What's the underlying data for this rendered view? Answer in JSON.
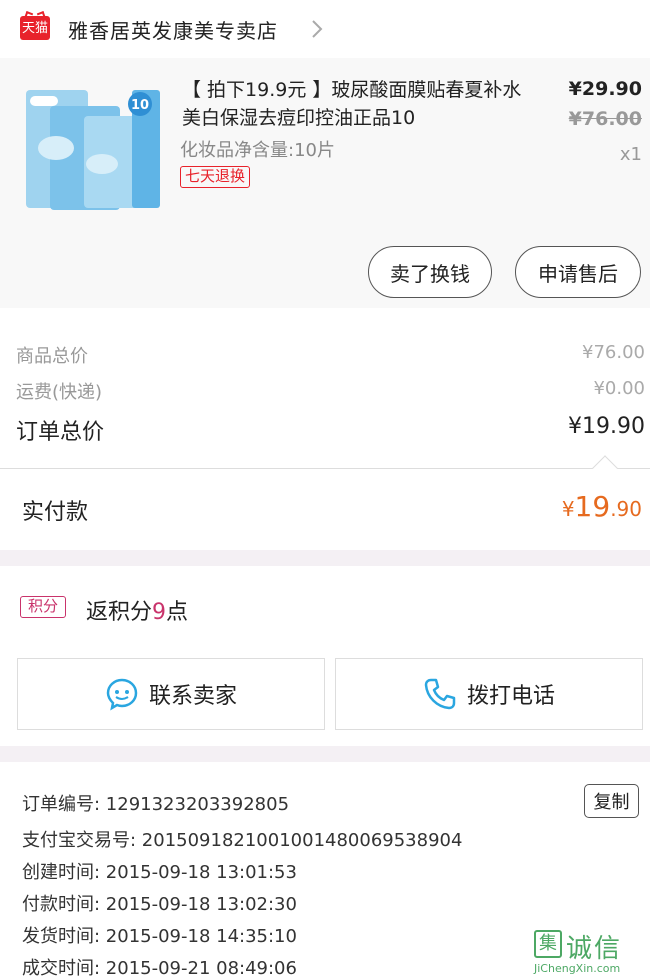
{
  "store": {
    "badge": "天猫",
    "name": "雅香居英发康美专卖店"
  },
  "product": {
    "title": "【 拍下19.9元 】玻尿酸面膜贴春夏补水美白保湿去痘印控油正品10",
    "spec": "化妆品净含量:10片",
    "return_badge": "七天退换",
    "price_now": "¥29.90",
    "price_old": "¥76.00",
    "qty": "x1",
    "image_badge": "10"
  },
  "actions": {
    "sell_label": "卖了换钱",
    "after_sale_label": "申请售后"
  },
  "summary": {
    "goods_total_label": "商品总价",
    "goods_total_value": "¥76.00",
    "shipping_label": "运费(快递)",
    "shipping_value": "¥0.00",
    "order_total_label": "订单总价",
    "order_total_value": "¥19.90"
  },
  "payment": {
    "paid_label": "实付款",
    "paid_symbol": "¥",
    "paid_int": "19",
    "paid_dec": ".90"
  },
  "points": {
    "badge": "积分",
    "prefix": "返积分",
    "value": "9",
    "suffix": "点"
  },
  "contact": {
    "seller_label": "联系卖家",
    "phone_label": "拨打电话"
  },
  "order_info": {
    "order_no": "订单编号: 1291323203392805",
    "alipay_no": "支付宝交易号: 2015091821001001480069538904",
    "created": "创建时间: 2015-09-18 13:01:53",
    "paid": "付款时间: 2015-09-18 13:02:30",
    "shipped": "发货时间: 2015-09-18 14:35:10",
    "completed": "成交时间: 2015-09-21 08:49:06",
    "copy_label": "复制"
  },
  "watermark": {
    "logo": "集",
    "text": "诚信",
    "url": "JiChengXin.com"
  },
  "colors": {
    "tmall_red": "#e8222b",
    "points_pink": "#c9336b",
    "paid_orange": "#e66a1f",
    "band_bg": "#f4f0f4"
  }
}
